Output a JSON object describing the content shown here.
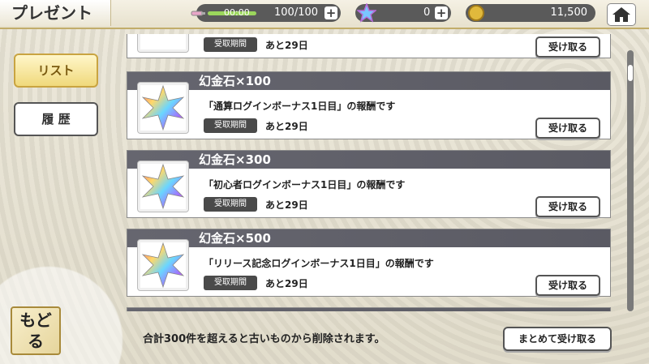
{
  "header": {
    "title": "プレゼント",
    "timer": "00:00",
    "stamina": "100/100",
    "stone_count": "0",
    "coin_count": "11,500"
  },
  "sidebar": {
    "list_label": "リスト",
    "history_label": "履 歴"
  },
  "presents": [
    {
      "title": "",
      "desc": "",
      "period_label": "受取期間",
      "period": "あと29日",
      "button": "受け取る"
    },
    {
      "title": "幻金石×100",
      "desc": "「通算ログインボーナス1日目」の報酬です",
      "period_label": "受取期間",
      "period": "あと29日",
      "button": "受け取る"
    },
    {
      "title": "幻金石×300",
      "desc": "「初心者ログインボーナス1日目」の報酬です",
      "period_label": "受取期間",
      "period": "あと29日",
      "button": "受け取る"
    },
    {
      "title": "幻金石×500",
      "desc": "「リリース記念ログインボーナス1日目」の報酬です",
      "period_label": "受取期間",
      "period": "あと29日",
      "button": "受け取る"
    }
  ],
  "footer": {
    "back_label": "もどる",
    "notice": "合計300件を超えると古いものから削除されます。",
    "receive_all": "まとめて受け取る"
  },
  "colors": {
    "accent_gold": "#c9a441",
    "header_bar": "#5a5a63"
  }
}
